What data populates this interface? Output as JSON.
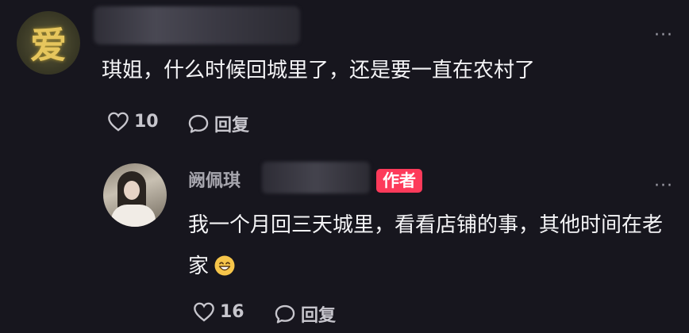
{
  "comment": {
    "avatar_text": "爱",
    "text": "琪姐，什么时候回城里了，还是要一直在农村了",
    "likes": "10",
    "reply_label": "回复"
  },
  "reply": {
    "username": "阙佩琪",
    "author_badge": "作者",
    "text": "我一个月回三天城里，看看店铺的事，其他时间在老家",
    "likes": "16",
    "reply_label": "回复"
  },
  "icons": {
    "more": "more-options-icon",
    "like": "heart-outline-icon",
    "reply": "chat-bubble-icon",
    "emoji": "grinning-face-emoji"
  },
  "colors": {
    "background": "#17161e",
    "badge": "#fd3a5a",
    "text": "#f4f4f6",
    "muted": "#a7a6ae"
  }
}
